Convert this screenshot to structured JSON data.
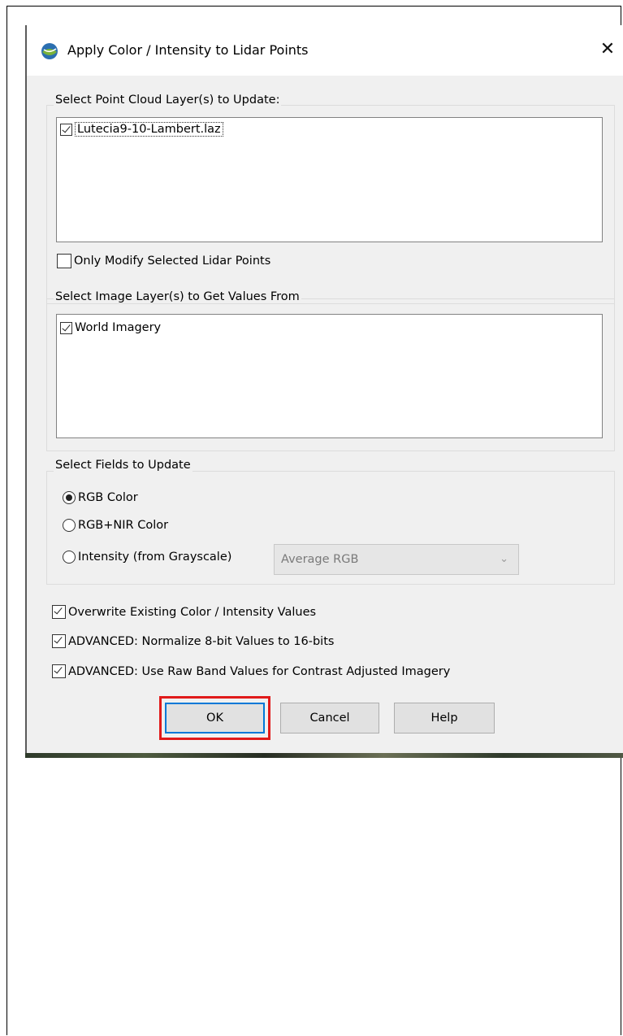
{
  "dialog": {
    "title": "Apply Color / Intensity to Lidar Points",
    "close_glyph": "✕"
  },
  "point_cloud_group": {
    "label": "Select Point Cloud Layer(s) to Update:",
    "items": [
      {
        "label": "Lutecia9-10-Lambert.laz",
        "checked": true
      }
    ],
    "only_selected": {
      "label": "Only Modify Selected Lidar Points",
      "checked": false
    }
  },
  "image_group": {
    "label": "Select Image Layer(s) to Get Values From",
    "items": [
      {
        "label": "World Imagery",
        "checked": true
      }
    ]
  },
  "fields_group": {
    "label": "Select Fields to Update",
    "options": [
      {
        "label": "RGB Color",
        "selected": true
      },
      {
        "label": "RGB+NIR Color",
        "selected": false
      },
      {
        "label": "Intensity (from Grayscale)",
        "selected": false
      }
    ],
    "intensity_select": {
      "value": "Average RGB",
      "disabled": true
    }
  },
  "options": [
    {
      "label": "Overwrite Existing Color / Intensity Values",
      "checked": true
    },
    {
      "label": "ADVANCED: Normalize 8-bit Values to 16-bits",
      "checked": true
    },
    {
      "label": "ADVANCED: Use Raw Band Values for Contrast Adjusted Imagery",
      "checked": true
    }
  ],
  "buttons": {
    "ok": "OK",
    "cancel": "Cancel",
    "help": "Help"
  },
  "colors": {
    "highlight": "#e11a1a",
    "default_button_border": "#0078d7",
    "dialog_bg": "#f0f0f0"
  },
  "icons": {
    "app": "globe-app-icon",
    "close": "close-icon",
    "dropdown": "chevron-down-icon"
  }
}
